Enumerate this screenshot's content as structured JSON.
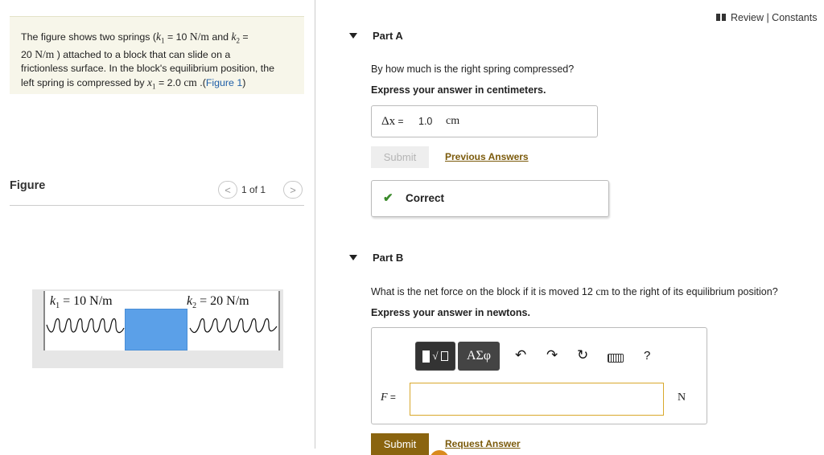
{
  "problem": {
    "t1": "The figure shows two springs (",
    "k1": "k",
    "k1_sub": "1",
    "t2": " = 10 ",
    "unit_nm_1": "N/m",
    "t3": " and ",
    "k2": "k",
    "k2_sub": "2",
    "t4": " =",
    "t5": "20 ",
    "unit_nm_2": "N/m",
    "t6": " ) attached to a block that can slide on a",
    "t7": "frictionless surface. In the block's equilibrium position, the",
    "t8": "left spring is compressed by ",
    "x1": "x",
    "x1_sub": "1",
    "t9": " = 2.0 ",
    "unit_cm": "cm",
    "t10": " .(",
    "figure_link": "Figure 1",
    "t11": ")"
  },
  "figure": {
    "title": "Figure",
    "counter": "1 of 1",
    "prev_icon": "chevron-left-icon",
    "next_icon": "chevron-right-icon",
    "k1_label_k": "k",
    "k1_label_sub": "1",
    "k1_label_rest": " = 10 N/m",
    "k2_label_k": "k",
    "k2_label_sub": "2",
    "k2_label_rest": " = 20 N/m",
    "block_color": "#5ba0e8"
  },
  "header": {
    "review_label": "Review | Constants"
  },
  "partA": {
    "title": "Part A",
    "question": "By how much is the right spring compressed?",
    "instruction": "Express your answer in centimeters.",
    "answer_label": "Δx",
    "answer_eq": " =",
    "answer_value": "1.0",
    "answer_unit": "cm",
    "submit_label": "Submit",
    "previous_answers_label": "Previous Answers",
    "feedback_label": "Correct",
    "feedback_color": "#3a8a2a"
  },
  "partB": {
    "title": "Part B",
    "question_pre": "What is the net force on the block if it is moved 12 ",
    "question_unit": "cm",
    "question_post": " to the right of its equilibrium position?",
    "instruction": "Express your answer in newtons.",
    "toolbar": {
      "greek_label": "ΑΣφ",
      "undo_icon": "undo-icon",
      "redo_icon": "redo-icon",
      "reset_icon": "reset-icon",
      "keyboard_icon": "keyboard-icon",
      "help_label": "?"
    },
    "field_label": "F",
    "field_eq": " =",
    "field_value": "",
    "unit": "N",
    "submit_label": "Submit",
    "request_answer_label": "Request Answer",
    "accent_color": "#8a640f"
  }
}
